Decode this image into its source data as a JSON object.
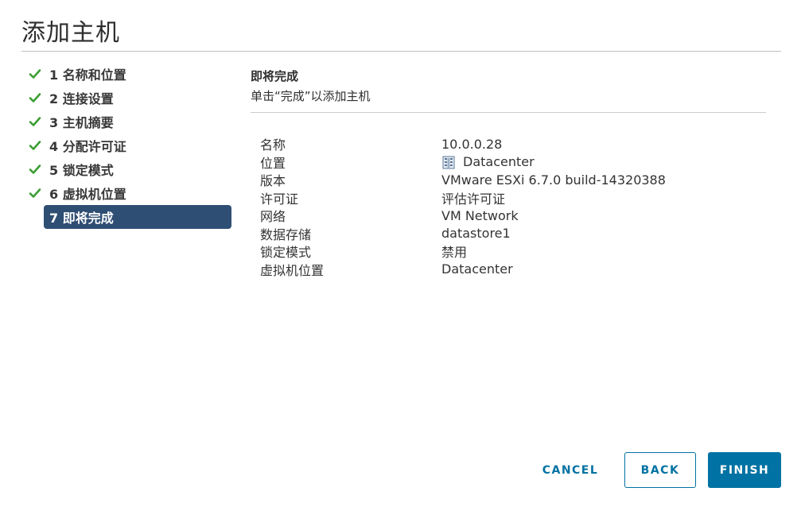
{
  "dialog": {
    "title": "添加主机"
  },
  "steps": [
    {
      "label": "1 名称和位置",
      "completed": true
    },
    {
      "label": "2 连接设置",
      "completed": true
    },
    {
      "label": "3 主机摘要",
      "completed": true
    },
    {
      "label": "4 分配许可证",
      "completed": true
    },
    {
      "label": "5 锁定模式",
      "completed": true
    },
    {
      "label": "6 虚拟机位置",
      "completed": true
    },
    {
      "label": "7 即将完成",
      "completed": false,
      "active": true
    }
  ],
  "main": {
    "title": "即将完成",
    "description": "单击“完成”以添加主机",
    "properties": [
      {
        "key": "名称",
        "value": "10.0.0.28"
      },
      {
        "key": "位置",
        "value": "Datacenter",
        "icon": "datacenter-icon"
      },
      {
        "key": "版本",
        "value": "VMware ESXi 6.7.0 build-14320388"
      },
      {
        "key": "许可证",
        "value": "评估许可证"
      },
      {
        "key": "网络",
        "value": "VM Network"
      },
      {
        "key": "数据存储",
        "value": "datastore1"
      },
      {
        "key": "锁定模式",
        "value": "禁用"
      },
      {
        "key": "虚拟机位置",
        "value": "Datacenter"
      }
    ]
  },
  "footer": {
    "cancel_label": "CANCEL",
    "back_label": "BACK",
    "finish_label": "FINISH"
  },
  "colors": {
    "active_step_bg": "#2f4e73",
    "check_green": "#3c9e33",
    "primary": "#0072a3"
  }
}
